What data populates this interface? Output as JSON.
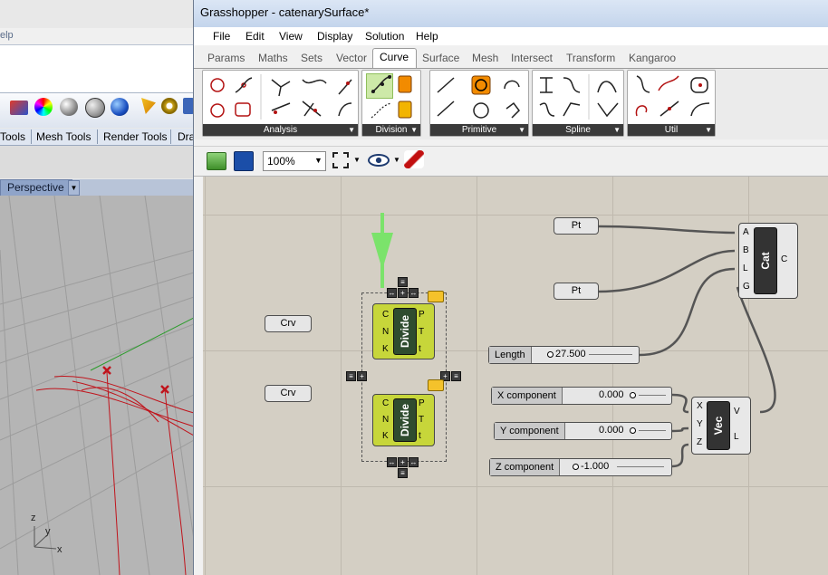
{
  "rhino": {
    "menu_fragment": "elp",
    "tabs": [
      "Tools",
      "Mesh Tools",
      "Render Tools",
      "Dra"
    ],
    "viewport_title": "Perspective",
    "axes": {
      "z": "z",
      "y": "y",
      "x": "x"
    }
  },
  "grasshopper": {
    "window_title": "Grasshopper - catenarySurface*",
    "menu": [
      "File",
      "Edit",
      "View",
      "Display",
      "Solution",
      "Help"
    ],
    "tabs": [
      "Params",
      "Maths",
      "Sets",
      "Vector",
      "Curve",
      "Surface",
      "Mesh",
      "Intersect",
      "Transform",
      "Kangaroo"
    ],
    "active_tab": "Curve",
    "panels": [
      "Analysis",
      "Division",
      "Primitive",
      "Spline",
      "Util"
    ],
    "zoom": "100%"
  },
  "canvas": {
    "curve_params": [
      "Crv",
      "Crv"
    ],
    "point_params": [
      "Pt",
      "Pt"
    ],
    "divide": {
      "name": "Divide",
      "inputs": [
        "C",
        "N",
        "K"
      ],
      "outputs": [
        "P",
        "T",
        "t"
      ]
    },
    "catenary": {
      "name": "Cat",
      "inputs": [
        "A",
        "B",
        "L",
        "G"
      ],
      "outputs": [
        "C"
      ]
    },
    "vector": {
      "name": "Vec",
      "inputs": [
        "X",
        "Y",
        "Z"
      ],
      "outputs": [
        "V",
        "L"
      ]
    },
    "sliders": [
      {
        "label": "Length",
        "value": "27.500"
      },
      {
        "label": "X component",
        "value": "0.000"
      },
      {
        "label": "Y component",
        "value": "0.000"
      },
      {
        "label": "Z component",
        "value": "-1.000"
      }
    ]
  },
  "colors": {
    "component_green": "#c7d63a",
    "annotation_arrow": "#7be36b",
    "canvas": "#d4cfc4",
    "curve_red": "#c0141c"
  }
}
